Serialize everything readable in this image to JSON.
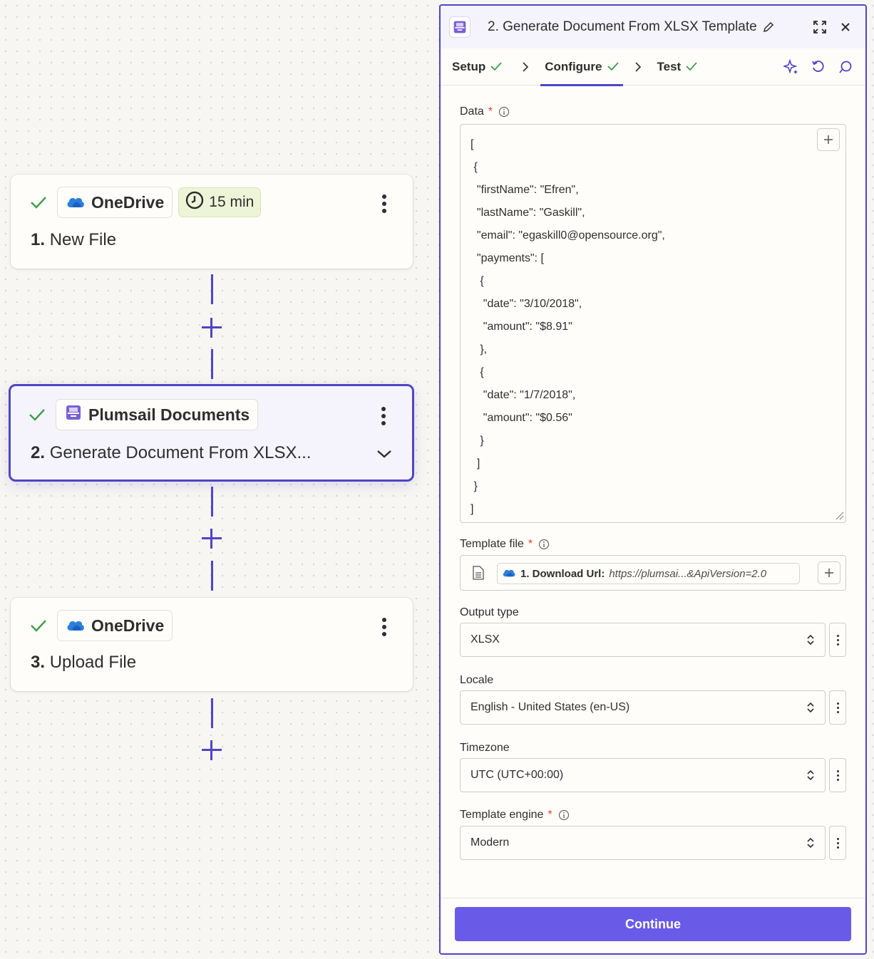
{
  "workflow": {
    "steps": [
      {
        "app": "OneDrive",
        "number": "1.",
        "title": "New File",
        "time_badge": "15 min",
        "status_icon": "check-icon",
        "app_icon": "onedrive-cloud-icon"
      },
      {
        "app": "Plumsail Documents",
        "number": "2.",
        "title": "Generate Document From XLSX...",
        "status_icon": "check-icon",
        "app_icon": "plumsail-documents-icon"
      },
      {
        "app": "OneDrive",
        "number": "3.",
        "title": "Upload File",
        "status_icon": "check-icon",
        "app_icon": "onedrive-cloud-icon"
      }
    ]
  },
  "panel": {
    "title": "2. Generate Document From XLSX Template",
    "tabs": [
      {
        "label": "Setup",
        "complete": true
      },
      {
        "label": "Configure",
        "complete": true,
        "active": true
      },
      {
        "label": "Test",
        "complete": true
      }
    ],
    "fields": {
      "data": {
        "label": "Data",
        "required": "*",
        "value": "[\n {\n  \"firstName\": \"Efren\",\n  \"lastName\": \"Gaskill\",\n  \"email\": \"egaskill0@opensource.org\",\n  \"payments\": [\n   {\n    \"date\": \"3/10/2018\",\n    \"amount\": \"$8.91\"\n   },\n   {\n    \"date\": \"1/7/2018\",\n    \"amount\": \"$0.56\"\n   }\n  ]\n }\n]"
      },
      "template_file": {
        "label": "Template file",
        "required": "*",
        "pill_label": "1. Download Url:",
        "pill_value": "https://plumsai...&ApiVersion=2.0"
      },
      "output_type": {
        "label": "Output type",
        "value": "XLSX"
      },
      "locale": {
        "label": "Locale",
        "value": "English - United States (en-US)"
      },
      "timezone": {
        "label": "Timezone",
        "value": "UTC (UTC+00:00)"
      },
      "template_engine": {
        "label": "Template engine",
        "required": "*",
        "value": "Modern"
      }
    },
    "continue_label": "Continue"
  },
  "colors": {
    "accent": "#4f45c5",
    "button": "#695be8",
    "success": "#3f9d4a",
    "required": "#e0422d",
    "time_badge_bg": "#edf5d8"
  }
}
